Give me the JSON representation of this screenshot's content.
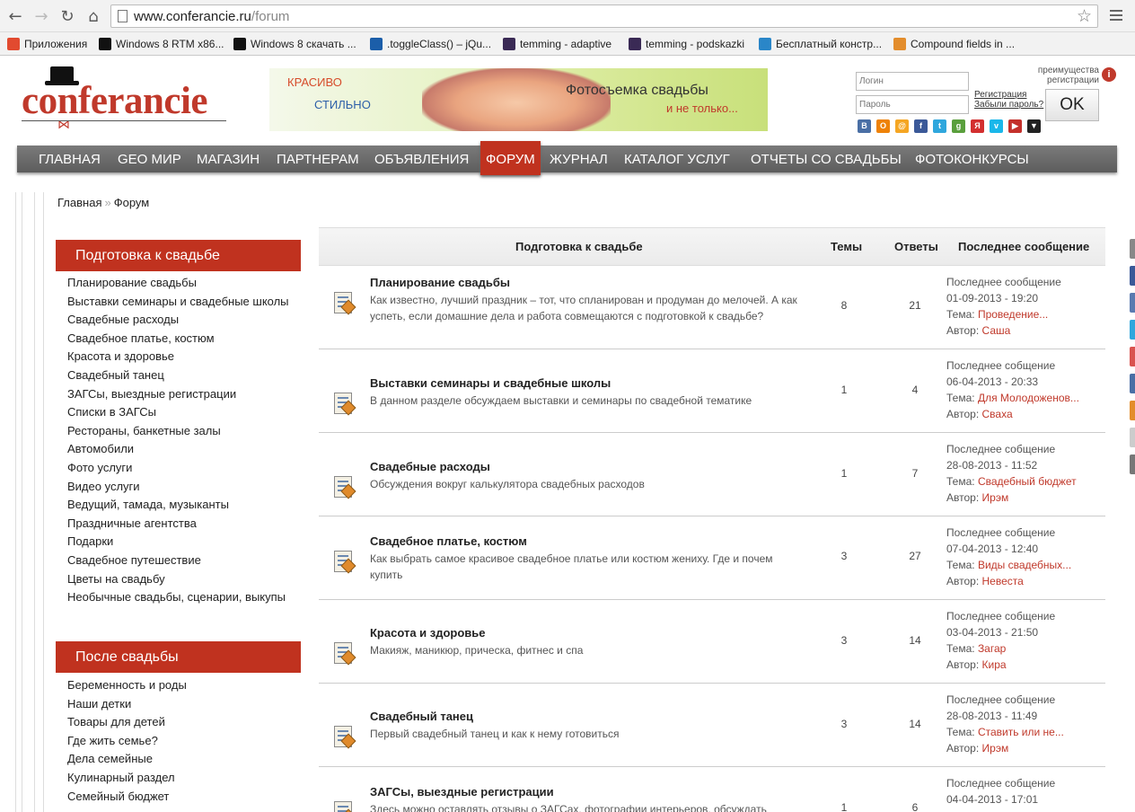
{
  "browser": {
    "url_host": "www.conferancie.ru",
    "url_path": "/forum",
    "bookmarks": [
      {
        "label": "Приложения",
        "color": "#e24a2f"
      },
      {
        "label": "Windows 8 RTM x86...",
        "color": "#111111"
      },
      {
        "label": "Windows 8 скачать ...",
        "color": "#111111"
      },
      {
        "label": ".toggleClass() – jQu...",
        "color": "#1b5ea9"
      },
      {
        "label": "temming - adaptive",
        "color": "#3a2a55"
      },
      {
        "label": "temming - podskazki",
        "color": "#3a2a55"
      },
      {
        "label": "Бесплатный констр...",
        "color": "#2a86c8"
      },
      {
        "label": "Compound fields in ...",
        "color": "#e38d2c"
      }
    ]
  },
  "header": {
    "logo_text": "conferancie",
    "banner": {
      "line1": "КРАСИВО",
      "line2": "СТИЛЬНО",
      "line3": "Фотосъемка свадьбы",
      "line4": "и не только..."
    },
    "login_placeholder": "Логин",
    "password_placeholder": "Пароль",
    "register_link": "Регистрация",
    "forgot_link": "Забыли пароль?",
    "ok_label": "OK",
    "advantages_text": "преимущества регистрации",
    "info_icon": "i",
    "social": [
      {
        "name": "vkontakte-icon",
        "glyph": "В",
        "color": "#4a6fa5"
      },
      {
        "name": "odnoklassniki-icon",
        "glyph": "О",
        "color": "#ee8208"
      },
      {
        "name": "mailru-icon",
        "glyph": "@",
        "color": "#f5a623"
      },
      {
        "name": "facebook-icon",
        "glyph": "f",
        "color": "#3b5998"
      },
      {
        "name": "twitter-icon",
        "glyph": "t",
        "color": "#2fa7dd"
      },
      {
        "name": "google-icon",
        "glyph": "g",
        "color": "#5a9f3d"
      },
      {
        "name": "yandex-icon",
        "glyph": "Я",
        "color": "#d32f2f"
      },
      {
        "name": "vimeo-icon",
        "glyph": "v",
        "color": "#1ab7ea"
      },
      {
        "name": "youtube-icon",
        "glyph": "▶",
        "color": "#c4302b"
      },
      {
        "name": "more-icon",
        "glyph": "▼",
        "color": "#222222"
      }
    ]
  },
  "nav": {
    "items": [
      {
        "label": "ГЛАВНАЯ"
      },
      {
        "label": "GEO МИР"
      },
      {
        "label": "МАГАЗИН"
      },
      {
        "label": "ПАРТНЕРАМ"
      },
      {
        "label": "ОБЪЯВЛЕНИЯ"
      },
      {
        "label": "ФОРУМ",
        "active": true
      },
      {
        "label": "ЖУРНАЛ"
      },
      {
        "label": "КАТАЛОГ УСЛУГ"
      },
      {
        "label": "ОТЧЕТЫ СО СВАДЬБЫ"
      },
      {
        "label": "ФОТОКОНКУРСЫ"
      }
    ]
  },
  "breadcrumb": {
    "home": "Главная",
    "sep": "»",
    "current": "Форум"
  },
  "sidebar": {
    "section1_title": "Подготовка к свадьбе",
    "section1_items": [
      "Планирование свадьбы",
      "Выставки семинары и свадебные школы",
      "Свадебные расходы",
      "Свадебное платье, костюм",
      "Красота и здоровье",
      "Свадебный танец",
      "ЗАГСы, выездные регистрации",
      "Списки в ЗАГСы",
      "Рестораны, банкетные залы",
      "Автомобили",
      "Фото услуги",
      "Видео услуги",
      "Ведущий, тамада, музыканты",
      "Праздничные агентства",
      "Подарки",
      "Свадебное путешествие",
      "Цветы на свадьбу",
      "Необычные свадьбы, сценарии, выкупы"
    ],
    "section2_title": "После свадьбы",
    "section2_items": [
      "Беременность и роды",
      "Наши детки",
      "Товары для детей",
      "Где жить семье?",
      "Дела семейные",
      "Кулинарный раздел",
      "Семейный бюджет"
    ]
  },
  "forum": {
    "header": {
      "section": "Подготовка к свадьбе",
      "topics": "Темы",
      "replies": "Ответы",
      "last": "Последнее сообщение"
    },
    "rows": [
      {
        "title": "Планирование свадьбы",
        "desc": "Как известно, лучший праздник – тот, что спланирован и продуман до мелочей. А как успеть, если домашние дела и работа совмещаются с подготовкой к свадьбе?",
        "topics": "8",
        "replies": "21",
        "last_label": "Последнее сообщение",
        "last_date": "01-09-2013 - 19:20",
        "topic_label": "Тема:",
        "topic": "Проведение...",
        "author_label": "Автор:",
        "author": "Саша"
      },
      {
        "title": "Выставки семинары и свадебные школы",
        "desc": "В данном разделе обсуждаем выставки и семинары по свадебной тематике",
        "topics": "1",
        "replies": "4",
        "last_label": "Последнее собщение",
        "last_date": "06-04-2013 - 20:33",
        "topic_label": "Тема:",
        "topic": "Для Молодоженов...",
        "author_label": "Автор:",
        "author": "Сваха"
      },
      {
        "title": "Свадебные расходы",
        "desc": "Обсуждения вокруг калькулятора свадебных расходов",
        "topics": "1",
        "replies": "7",
        "last_label": "Последнее собщение",
        "last_date": "28-08-2013 - 11:52",
        "topic_label": "Тема:",
        "topic": "Свадебный бюджет",
        "author_label": "Автор:",
        "author": "Ирэм"
      },
      {
        "title": "Свадебное платье, костюм",
        "desc": "Как выбрать самое красивое свадебное платье или костюм жениху. Где и почем купить",
        "topics": "3",
        "replies": "27",
        "last_label": "Последнее собщение",
        "last_date": "07-04-2013 - 12:40",
        "topic_label": "Тема:",
        "topic": "Виды свадебных...",
        "author_label": "Автор:",
        "author": "Невеста"
      },
      {
        "title": "Красота и здоровье",
        "desc": "Макияж, маникюр, прическа, фитнес и спа",
        "topics": "3",
        "replies": "14",
        "last_label": "Последнее собщение",
        "last_date": "03-04-2013 - 21:50",
        "topic_label": "Тема:",
        "topic": "Загар",
        "author_label": "Автор:",
        "author": "Кира"
      },
      {
        "title": "Свадебный танец",
        "desc": "Первый свадебный танец и как к нему готовиться",
        "topics": "3",
        "replies": "14",
        "last_label": "Последнее собщение",
        "last_date": "28-08-2013 - 11:49",
        "topic_label": "Тема:",
        "topic": "Ставить или не...",
        "author_label": "Автор:",
        "author": "Ирэм"
      },
      {
        "title": "ЗАГСы, выездные регистрации",
        "desc": "Здесь можно оставлять отзывы о ЗАГСах, фотографии интерьеров, обсуждать",
        "topics": "1",
        "replies": "6",
        "last_label": "Последнее собщение",
        "last_date": "04-04-2013 - 17:01",
        "topic_label": "",
        "topic": "",
        "author_label": "",
        "author": ""
      }
    ]
  },
  "share_strip_colors": [
    "#888888",
    "#3b5998",
    "#5a7ab0",
    "#2fa7dd",
    "#d9534f",
    "#4a6fa5",
    "#e38d2c",
    "#cccccc",
    "#777777"
  ]
}
